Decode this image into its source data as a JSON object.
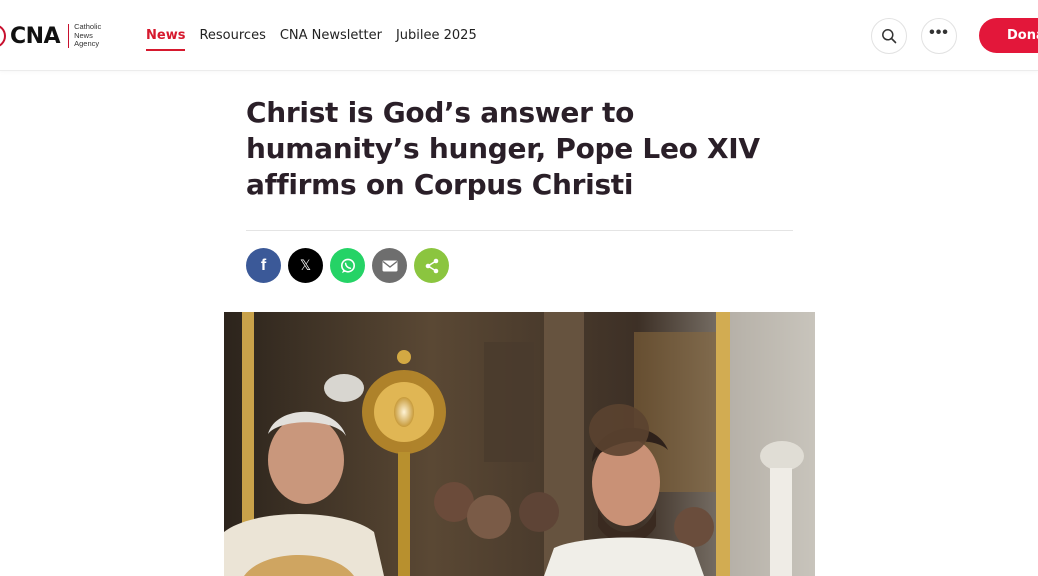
{
  "header": {
    "logo_text": "CNA",
    "logo_sub": [
      "Catholic",
      "News",
      "Agency"
    ],
    "nav": [
      {
        "label": "News",
        "active": true
      },
      {
        "label": "Resources",
        "active": false
      },
      {
        "label": "CNA Newsletter",
        "active": false
      },
      {
        "label": "Jubilee 2025",
        "active": false
      }
    ],
    "search_icon": "search-icon",
    "more_icon": "more-horizontal-icon",
    "more_glyph": "•••",
    "donate_label": "Donate"
  },
  "article": {
    "title": "Christ is God’s answer to humanity’s hunger, Pope Leo XIV affirms on Corpus Christi",
    "share": [
      {
        "name": "facebook",
        "icon": "facebook-icon",
        "glyph": "f",
        "color": "#3b5998"
      },
      {
        "name": "x",
        "icon": "x-icon",
        "glyph": "𝕏",
        "color": "#000000"
      },
      {
        "name": "whatsapp",
        "icon": "whatsapp-icon",
        "color": "#25d366"
      },
      {
        "name": "email",
        "icon": "email-icon",
        "color": "#6e6e6e"
      },
      {
        "name": "share",
        "icon": "share-icon",
        "color": "#8bc53f"
      }
    ]
  },
  "colors": {
    "accent": "#d6192e",
    "donate": "#e3173a",
    "title": "#2a1f28"
  }
}
